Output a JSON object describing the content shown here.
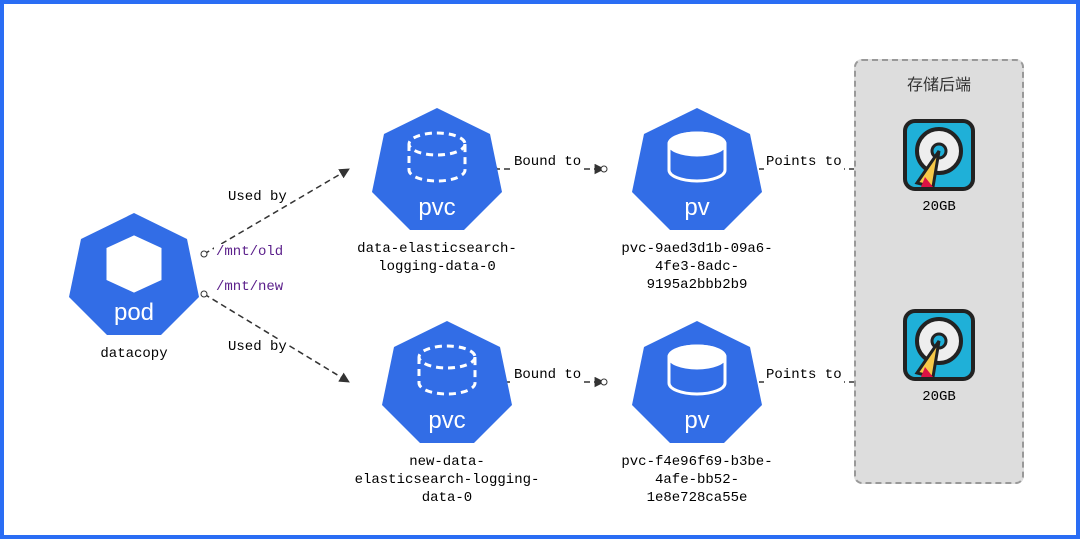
{
  "pod": {
    "kind": "pod",
    "name": "datacopy"
  },
  "pvc": [
    {
      "kind": "pvc",
      "name": "data-elasticsearch-logging-data-0",
      "mount": "/mnt/old"
    },
    {
      "kind": "pvc",
      "name": "new-data-elasticsearch-logging-data-0",
      "mount": "/mnt/new"
    }
  ],
  "pv": [
    {
      "kind": "pv",
      "name": "pvc-9aed3d1b-09a6-4fe3-8adc-9195a2bbb2b9"
    },
    {
      "kind": "pv",
      "name": "pvc-f4e96f69-b3be-4afe-bb52-1e8e728ca55e"
    }
  ],
  "storage": {
    "title": "存储后端",
    "disks": [
      {
        "size": "20GB"
      },
      {
        "size": "20GB"
      }
    ]
  },
  "edges": {
    "used_by": "Used by",
    "bound_to": "Bound to",
    "points_to": "Points to"
  }
}
